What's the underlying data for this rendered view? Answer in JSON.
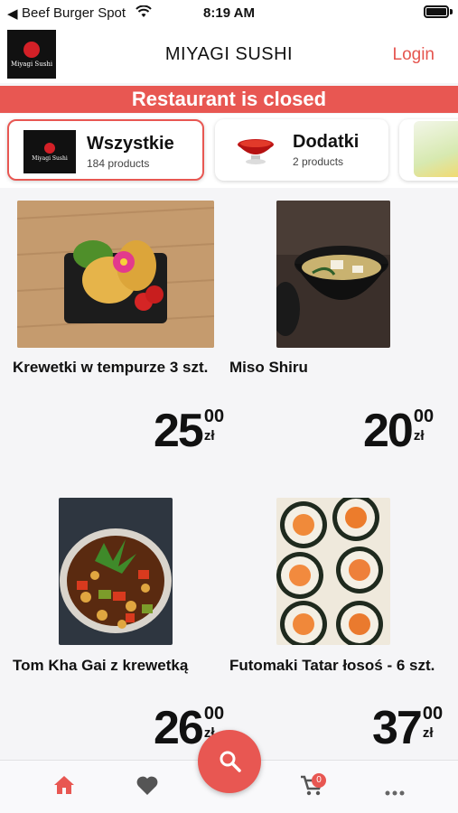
{
  "status_bar": {
    "back_glyph": "◀",
    "carrier": "Beef Burger Spot",
    "time": "8:19 AM"
  },
  "header": {
    "logo_text": "Miyagi Sushi",
    "title": "MIYAGI SUSHI",
    "login_label": "Login"
  },
  "banner": {
    "text": "Restaurant is closed",
    "color": "#e85752"
  },
  "categories": [
    {
      "name": "Wszystkie",
      "count": "184 products",
      "image": "miyagi-logo",
      "active": true
    },
    {
      "name": "Dodatki",
      "count": "2 products",
      "image": "sauce-bowl",
      "active": false
    },
    {
      "name": "",
      "count": "",
      "image": "drink-glasses",
      "active": false
    }
  ],
  "products": [
    {
      "name": "Krewetki w tempurze 3 szt.",
      "price_main": "25",
      "price_cents": "00",
      "currency": "zł",
      "image": "tempura-shrimp"
    },
    {
      "name": "Miso Shiru",
      "price_main": "20",
      "price_cents": "00",
      "currency": "zł",
      "image": "miso-soup"
    },
    {
      "name": "Tom Kha Gai z krewetką",
      "price_main": "26",
      "price_cents": "00",
      "currency": "zł",
      "image": "curry-dish"
    },
    {
      "name": "Futomaki Tatar łosoś - 6 szt.",
      "price_main": "37",
      "price_cents": "00",
      "currency": "zł",
      "image": "futomaki-rolls"
    }
  ],
  "bottom_nav": {
    "items": [
      "home-icon",
      "heart-icon",
      "search-icon",
      "cart-icon",
      "more-icon"
    ],
    "cart_count": "0"
  },
  "colors": {
    "accent": "#e85752",
    "login": "#e5554f",
    "background": "#f5f5f7"
  }
}
